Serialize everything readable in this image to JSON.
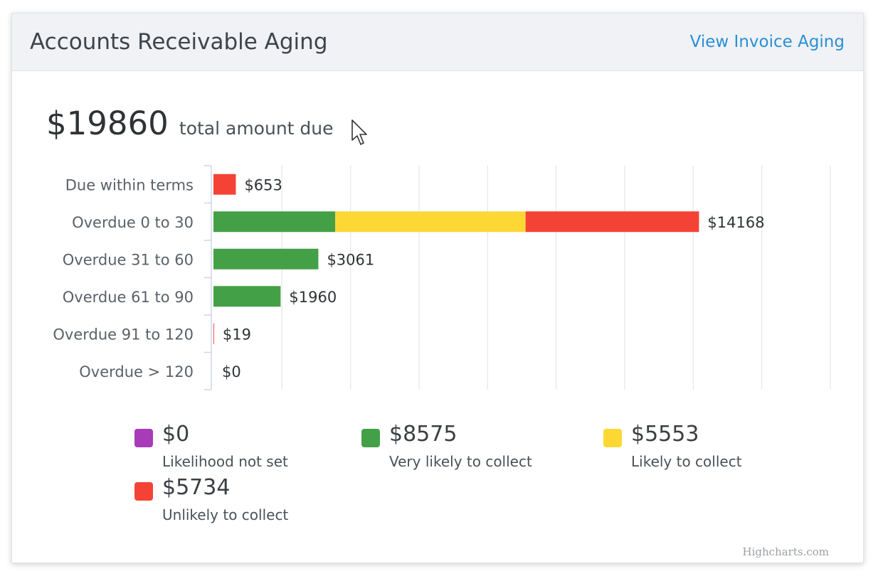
{
  "header": {
    "title": "Accounts Receivable Aging",
    "link_label": "View Invoice Aging"
  },
  "summary": {
    "total_amount": "$19860",
    "total_label": "total amount due"
  },
  "colors": {
    "not_set": "#a83bb8",
    "very_likely": "#43a047",
    "likely": "#fdd835",
    "unlikely": "#f44336",
    "grid": "#e6e6e6",
    "axis": "#ccd6eb"
  },
  "chart_data": {
    "type": "bar",
    "stacked": true,
    "orientation": "horizontal",
    "categories": [
      "Due within terms",
      "Overdue 0 to 30",
      "Overdue 31 to 60",
      "Overdue 61 to 90",
      "Overdue 91 to 120",
      "Overdue > 120"
    ],
    "series": [
      {
        "name": "Likelihood not set",
        "color": "#a83bb8",
        "values": [
          0,
          0,
          0,
          0,
          0,
          0
        ]
      },
      {
        "name": "Very likely to collect",
        "color": "#43a047",
        "values": [
          0,
          3554,
          3061,
          1960,
          0,
          0
        ]
      },
      {
        "name": "Likely to collect",
        "color": "#fdd835",
        "values": [
          0,
          5553,
          0,
          0,
          0,
          0
        ]
      },
      {
        "name": "Unlikely to collect",
        "color": "#f44336",
        "values": [
          653,
          5061,
          0,
          0,
          19,
          0
        ]
      }
    ],
    "totals_labels": [
      "$653",
      "$14168",
      "$3061",
      "$1960",
      "$19",
      "$0"
    ],
    "totals": [
      653,
      14168,
      3061,
      1960,
      19,
      0
    ],
    "xlim": [
      0,
      18000
    ],
    "grid": true,
    "legend_position": "bottom"
  },
  "legend": [
    {
      "value": "$0",
      "label": "Likelihood not set",
      "color": "#a83bb8"
    },
    {
      "value": "$8575",
      "label": "Very likely to collect",
      "color": "#43a047"
    },
    {
      "value": "$5553",
      "label": "Likely to collect",
      "color": "#fdd835"
    },
    {
      "value": "$5734",
      "label": "Unlikely to collect",
      "color": "#f44336"
    }
  ],
  "credits": "Highcharts.com"
}
